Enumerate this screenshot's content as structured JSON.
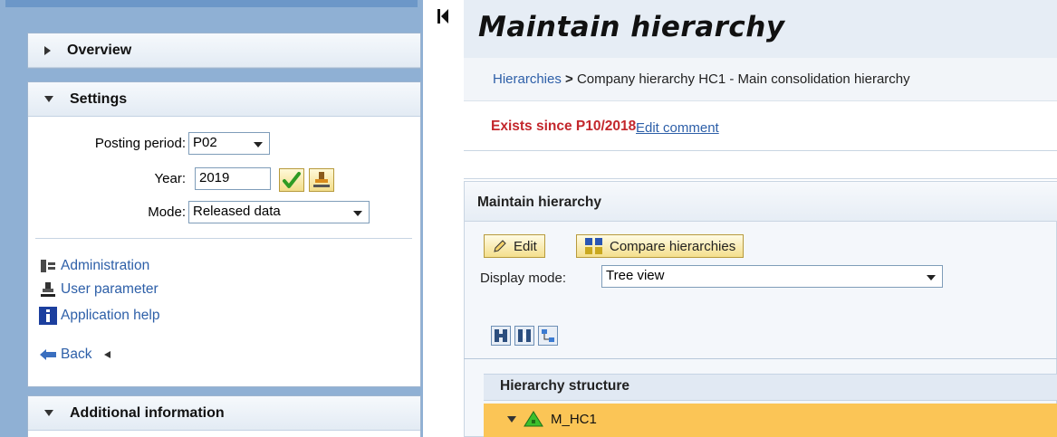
{
  "nav": {
    "overview": {
      "label": "Overview"
    },
    "settings": {
      "label": "Settings",
      "posting_period": {
        "label": "Posting period:",
        "value": "P02"
      },
      "year": {
        "label": "Year:",
        "value": "2019"
      },
      "mode": {
        "label": "Mode:",
        "value": "Released data"
      }
    },
    "links": {
      "administration": "Administration",
      "user_parameter": "User parameter",
      "application_help": "Application help",
      "back": "Back"
    },
    "additional_information": {
      "label": "Additional information"
    }
  },
  "main": {
    "title": "Maintain hierarchy",
    "breadcrumb": {
      "root": "Hierarchies",
      "separator": ">",
      "current": "Company hierarchy HC1 - Main consolidation hierarchy"
    },
    "status": {
      "text": "Exists since P10/2018",
      "color": "#c3272c",
      "link": "Edit comment"
    },
    "panel": {
      "title": "Maintain hierarchy",
      "buttons": {
        "edit": "Edit",
        "compare": "Compare hierarchies"
      },
      "display_mode": {
        "label": "Display mode:",
        "value": "Tree view"
      },
      "toolbar_icons": [
        "expand-all-icon",
        "collapse-all-icon",
        "tree-layout-icon"
      ],
      "tree": {
        "header": "Hierarchy structure",
        "rows": [
          {
            "label": "M_HC1",
            "icon": "hierarchy-node-icon",
            "selected": true,
            "highlight": "#fbc556"
          }
        ]
      }
    }
  },
  "colors": {
    "link": "#2d5fa8",
    "left_background": "#8fb0d4",
    "title_bar": "#e6edf5"
  }
}
